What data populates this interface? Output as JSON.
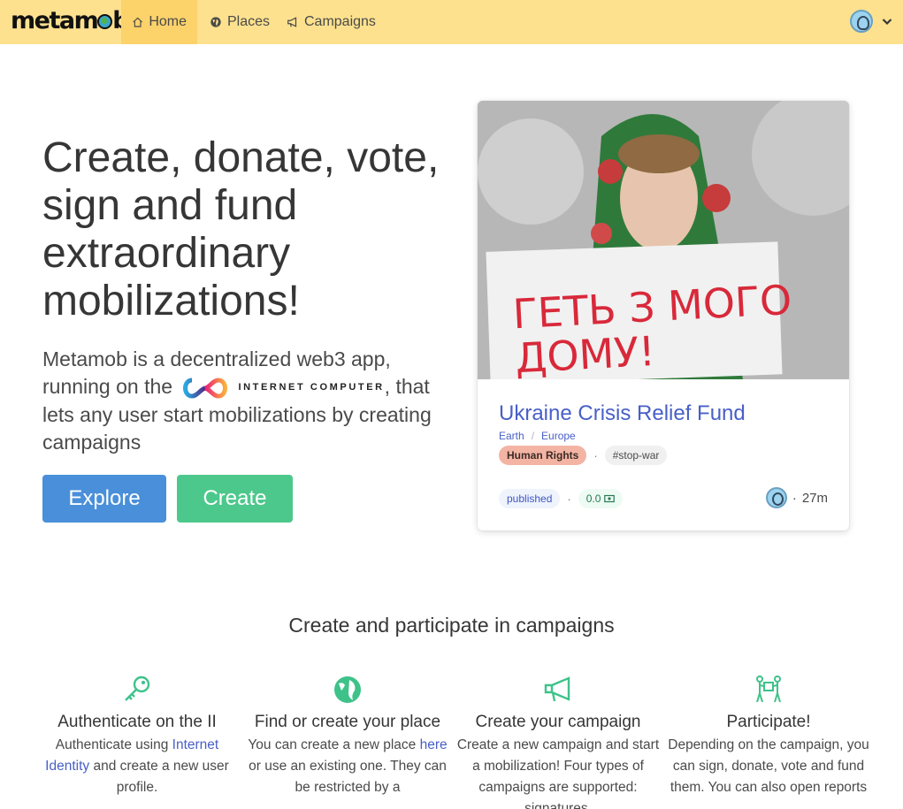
{
  "nav": {
    "logo": "metamob",
    "items": [
      {
        "label": "Home",
        "icon": "home-icon",
        "active": true
      },
      {
        "label": "Places",
        "icon": "globe-icon",
        "active": false
      },
      {
        "label": "Campaigns",
        "icon": "megaphone-icon",
        "active": false
      }
    ],
    "user_menu_icon": "chevron-down-icon"
  },
  "hero": {
    "title": "Create, donate, vote, sign and fund extraordinary mobilizations!",
    "sub_before": "Metamob is a decentralized web3 app, running on the",
    "ic_label": "INTERNET COMPUTER",
    "sub_after": ", that lets any user start mobilizations by creating campaigns",
    "explore_label": "Explore",
    "create_label": "Create"
  },
  "featured_campaign": {
    "title": "Ukraine Crisis Relief Fund",
    "breadcrumb": [
      "Earth",
      "Europe"
    ],
    "category": "Human Rights",
    "hashtag": "#stop-war",
    "status": "published",
    "value": "0.0",
    "age": "27m",
    "image_sign_text": "ГЕТЬ З МОГО ДОМУ!"
  },
  "section": {
    "title": "Create and participate in campaigns"
  },
  "features": [
    {
      "icon": "key-icon",
      "title": "Authenticate on the II",
      "text_before": "Authenticate using",
      "link": "Internet Identity",
      "text_after": "and create a new user profile."
    },
    {
      "icon": "globe-icon",
      "title": "Find or create your place",
      "text_before": "You can create a new place",
      "link": "here",
      "text_after": "or use an existing one. They can be restricted by a"
    },
    {
      "icon": "megaphone-icon",
      "title": "Create your campaign",
      "text": "Create a new campaign and start a mobilization! Four types of campaigns are supported: signatures,"
    },
    {
      "icon": "people-box-icon",
      "title": "Participate!",
      "text": "Depending on the campaign, you can sign, donate, vote and fund them. You can also open reports"
    }
  ],
  "colors": {
    "navbar": "#fde18e",
    "navbar_active": "#fcd26b",
    "explore": "#4a8fd9",
    "create": "#4dc88c",
    "link": "#485fc7",
    "feature_icon": "#3ec28a"
  }
}
